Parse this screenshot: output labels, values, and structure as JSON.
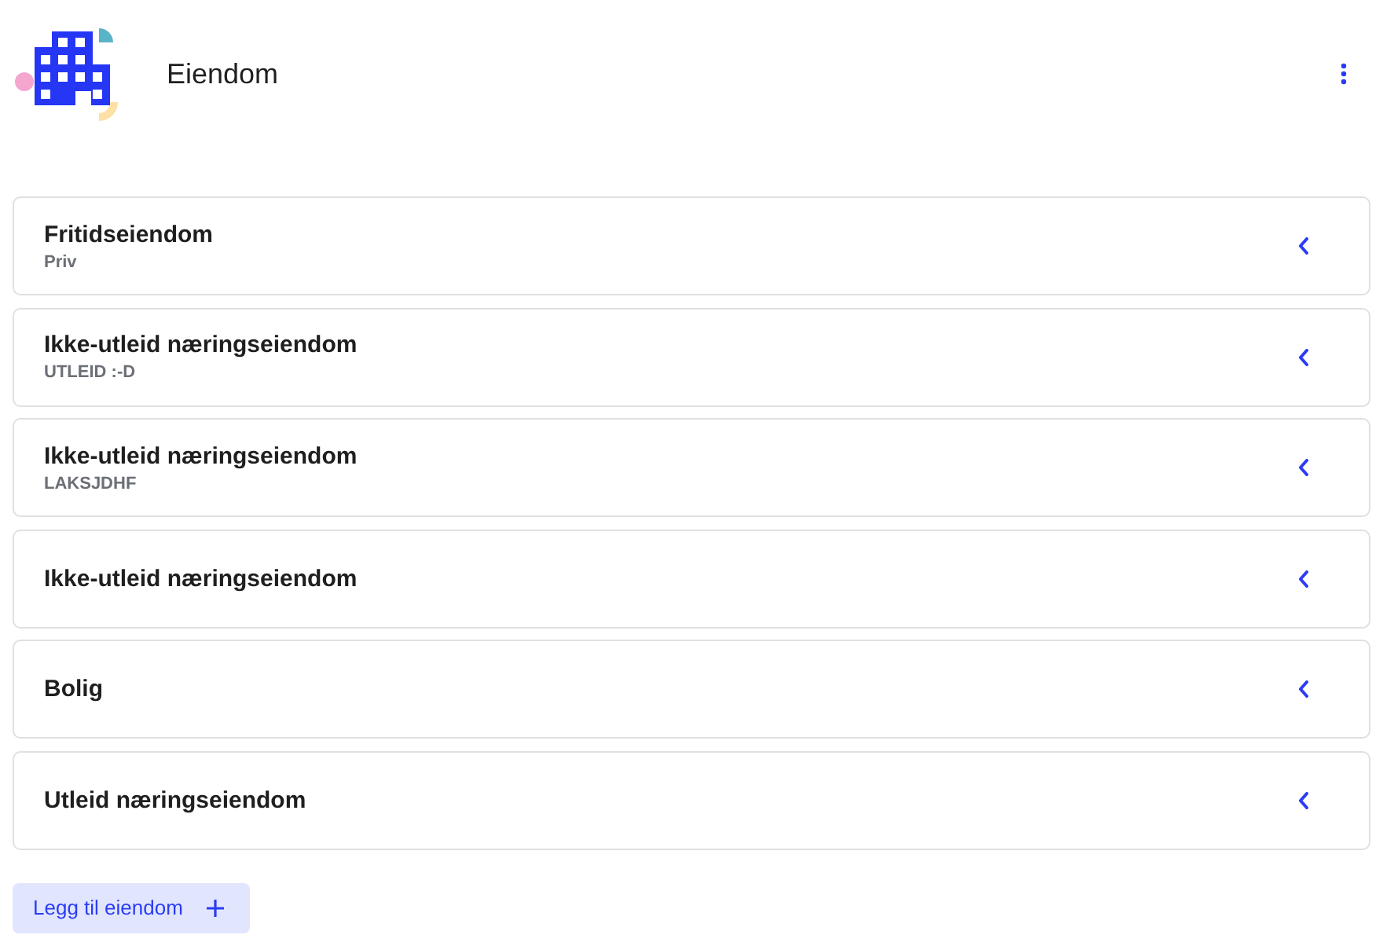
{
  "header": {
    "title": "Eiendom"
  },
  "properties": [
    {
      "title": "Fritidseiendom",
      "subtitle": "Priv"
    },
    {
      "title": "Ikke-utleid næringseiendom",
      "subtitle": "UTLEID :-D"
    },
    {
      "title": "Ikke-utleid næringseiendom",
      "subtitle": "LAKSJDHF"
    },
    {
      "title": "Ikke-utleid næringseiendom"
    },
    {
      "title": "Bolig"
    },
    {
      "title": "Utleid næringseiendom"
    }
  ],
  "add_button": {
    "label": "Legg til eiendom"
  }
}
